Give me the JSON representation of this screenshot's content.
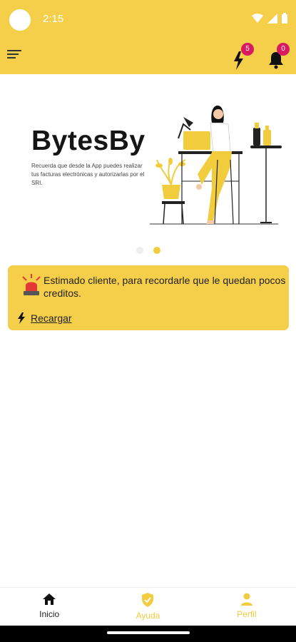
{
  "status_bar": {
    "time": "2:15",
    "icons": [
      "wifi-icon",
      "signal-icon",
      "battery-icon"
    ]
  },
  "app_bar": {
    "menu_icon": "menu-icon",
    "credits_badge": "5",
    "notifications_badge": "0"
  },
  "banner": {
    "brand": "BytesBy",
    "description": "Recuerda que desde la App puedes realizar tus facturas electrónicas y autorizarlas por el SRI.",
    "active_slide": 2,
    "slide_count": 2
  },
  "alert": {
    "message": "Estimado cliente, para recordarle que le quedan pocos creditos.",
    "action_label": "Recargar"
  },
  "bottom_nav": {
    "items": [
      {
        "label": "Inicio",
        "icon": "home-icon",
        "active": true
      },
      {
        "label": "Ayuda",
        "icon": "shield-check-icon",
        "active": false
      },
      {
        "label": "Perfil",
        "icon": "person-icon",
        "active": false
      }
    ]
  },
  "colors": {
    "primary": "#f5cf4a",
    "badge": "#d81b60",
    "siren": "#e53935",
    "text": "#222222"
  }
}
